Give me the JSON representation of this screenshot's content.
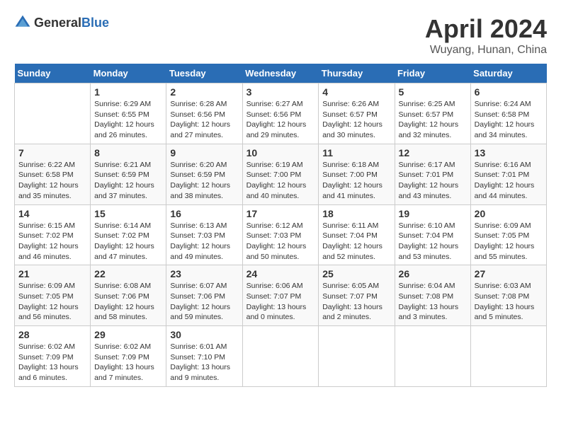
{
  "header": {
    "logo_general": "General",
    "logo_blue": "Blue",
    "month_title": "April 2024",
    "location": "Wuyang, Hunan, China"
  },
  "calendar": {
    "days_of_week": [
      "Sunday",
      "Monday",
      "Tuesday",
      "Wednesday",
      "Thursday",
      "Friday",
      "Saturday"
    ],
    "weeks": [
      [
        {
          "day": "",
          "info": ""
        },
        {
          "day": "1",
          "info": "Sunrise: 6:29 AM\nSunset: 6:55 PM\nDaylight: 12 hours\nand 26 minutes."
        },
        {
          "day": "2",
          "info": "Sunrise: 6:28 AM\nSunset: 6:56 PM\nDaylight: 12 hours\nand 27 minutes."
        },
        {
          "day": "3",
          "info": "Sunrise: 6:27 AM\nSunset: 6:56 PM\nDaylight: 12 hours\nand 29 minutes."
        },
        {
          "day": "4",
          "info": "Sunrise: 6:26 AM\nSunset: 6:57 PM\nDaylight: 12 hours\nand 30 minutes."
        },
        {
          "day": "5",
          "info": "Sunrise: 6:25 AM\nSunset: 6:57 PM\nDaylight: 12 hours\nand 32 minutes."
        },
        {
          "day": "6",
          "info": "Sunrise: 6:24 AM\nSunset: 6:58 PM\nDaylight: 12 hours\nand 34 minutes."
        }
      ],
      [
        {
          "day": "7",
          "info": "Sunrise: 6:22 AM\nSunset: 6:58 PM\nDaylight: 12 hours\nand 35 minutes."
        },
        {
          "day": "8",
          "info": "Sunrise: 6:21 AM\nSunset: 6:59 PM\nDaylight: 12 hours\nand 37 minutes."
        },
        {
          "day": "9",
          "info": "Sunrise: 6:20 AM\nSunset: 6:59 PM\nDaylight: 12 hours\nand 38 minutes."
        },
        {
          "day": "10",
          "info": "Sunrise: 6:19 AM\nSunset: 7:00 PM\nDaylight: 12 hours\nand 40 minutes."
        },
        {
          "day": "11",
          "info": "Sunrise: 6:18 AM\nSunset: 7:00 PM\nDaylight: 12 hours\nand 41 minutes."
        },
        {
          "day": "12",
          "info": "Sunrise: 6:17 AM\nSunset: 7:01 PM\nDaylight: 12 hours\nand 43 minutes."
        },
        {
          "day": "13",
          "info": "Sunrise: 6:16 AM\nSunset: 7:01 PM\nDaylight: 12 hours\nand 44 minutes."
        }
      ],
      [
        {
          "day": "14",
          "info": "Sunrise: 6:15 AM\nSunset: 7:02 PM\nDaylight: 12 hours\nand 46 minutes."
        },
        {
          "day": "15",
          "info": "Sunrise: 6:14 AM\nSunset: 7:02 PM\nDaylight: 12 hours\nand 47 minutes."
        },
        {
          "day": "16",
          "info": "Sunrise: 6:13 AM\nSunset: 7:03 PM\nDaylight: 12 hours\nand 49 minutes."
        },
        {
          "day": "17",
          "info": "Sunrise: 6:12 AM\nSunset: 7:03 PM\nDaylight: 12 hours\nand 50 minutes."
        },
        {
          "day": "18",
          "info": "Sunrise: 6:11 AM\nSunset: 7:04 PM\nDaylight: 12 hours\nand 52 minutes."
        },
        {
          "day": "19",
          "info": "Sunrise: 6:10 AM\nSunset: 7:04 PM\nDaylight: 12 hours\nand 53 minutes."
        },
        {
          "day": "20",
          "info": "Sunrise: 6:09 AM\nSunset: 7:05 PM\nDaylight: 12 hours\nand 55 minutes."
        }
      ],
      [
        {
          "day": "21",
          "info": "Sunrise: 6:09 AM\nSunset: 7:05 PM\nDaylight: 12 hours\nand 56 minutes."
        },
        {
          "day": "22",
          "info": "Sunrise: 6:08 AM\nSunset: 7:06 PM\nDaylight: 12 hours\nand 58 minutes."
        },
        {
          "day": "23",
          "info": "Sunrise: 6:07 AM\nSunset: 7:06 PM\nDaylight: 12 hours\nand 59 minutes."
        },
        {
          "day": "24",
          "info": "Sunrise: 6:06 AM\nSunset: 7:07 PM\nDaylight: 13 hours\nand 0 minutes."
        },
        {
          "day": "25",
          "info": "Sunrise: 6:05 AM\nSunset: 7:07 PM\nDaylight: 13 hours\nand 2 minutes."
        },
        {
          "day": "26",
          "info": "Sunrise: 6:04 AM\nSunset: 7:08 PM\nDaylight: 13 hours\nand 3 minutes."
        },
        {
          "day": "27",
          "info": "Sunrise: 6:03 AM\nSunset: 7:08 PM\nDaylight: 13 hours\nand 5 minutes."
        }
      ],
      [
        {
          "day": "28",
          "info": "Sunrise: 6:02 AM\nSunset: 7:09 PM\nDaylight: 13 hours\nand 6 minutes."
        },
        {
          "day": "29",
          "info": "Sunrise: 6:02 AM\nSunset: 7:09 PM\nDaylight: 13 hours\nand 7 minutes."
        },
        {
          "day": "30",
          "info": "Sunrise: 6:01 AM\nSunset: 7:10 PM\nDaylight: 13 hours\nand 9 minutes."
        },
        {
          "day": "",
          "info": ""
        },
        {
          "day": "",
          "info": ""
        },
        {
          "day": "",
          "info": ""
        },
        {
          "day": "",
          "info": ""
        }
      ]
    ]
  }
}
